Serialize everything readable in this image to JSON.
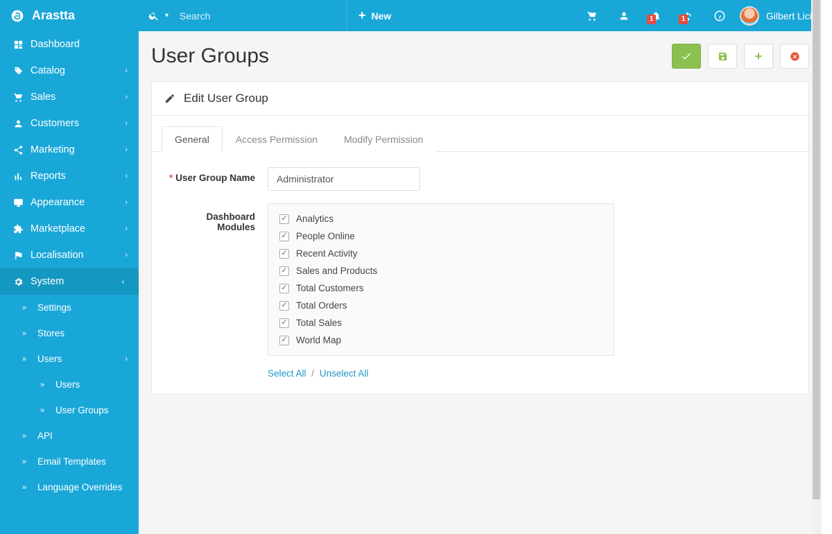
{
  "brand": {
    "name": "Arastta"
  },
  "topbar": {
    "search_placeholder": "Search",
    "new_label": "New",
    "bell_badge": "1",
    "sync_badge": "1",
    "user_name": "Gilbert Lici"
  },
  "sidebar": {
    "items": [
      {
        "label": "Dashboard",
        "icon": "dashboard",
        "expandable": false
      },
      {
        "label": "Catalog",
        "icon": "tag",
        "expandable": true
      },
      {
        "label": "Sales",
        "icon": "cart",
        "expandable": true
      },
      {
        "label": "Customers",
        "icon": "user",
        "expandable": true
      },
      {
        "label": "Marketing",
        "icon": "share",
        "expandable": true
      },
      {
        "label": "Reports",
        "icon": "bars",
        "expandable": true
      },
      {
        "label": "Appearance",
        "icon": "desktop",
        "expandable": true
      },
      {
        "label": "Marketplace",
        "icon": "puzzle",
        "expandable": true
      },
      {
        "label": "Localisation",
        "icon": "flag",
        "expandable": true
      },
      {
        "label": "System",
        "icon": "cog",
        "expandable": true,
        "expanded": true
      }
    ],
    "system_sub": [
      {
        "label": "Settings"
      },
      {
        "label": "Stores"
      },
      {
        "label": "Users",
        "expandable": true,
        "expanded": true
      },
      {
        "label": "API"
      },
      {
        "label": "Email Templates"
      },
      {
        "label": "Language Overrides"
      }
    ],
    "users_sub": [
      {
        "label": "Users"
      },
      {
        "label": "User Groups"
      }
    ]
  },
  "page": {
    "title": "User Groups",
    "panel_title": "Edit User Group",
    "tabs": [
      "General",
      "Access Permission",
      "Modify Permission"
    ],
    "active_tab": 0,
    "form": {
      "name_label": "User Group Name",
      "name_value": "Administrator",
      "modules_label": "Dashboard Modules",
      "modules": [
        {
          "label": "Analytics",
          "checked": true
        },
        {
          "label": "People Online",
          "checked": true
        },
        {
          "label": "Recent Activity",
          "checked": true
        },
        {
          "label": "Sales and Products",
          "checked": true
        },
        {
          "label": "Total Customers",
          "checked": true
        },
        {
          "label": "Total Orders",
          "checked": true
        },
        {
          "label": "Total Sales",
          "checked": true
        },
        {
          "label": "World Map",
          "checked": true
        }
      ],
      "select_all": "Select All",
      "unselect_all": "Unselect All"
    }
  },
  "colors": {
    "primary": "#19a7d8",
    "primary_dark": "#1497c1",
    "green": "#8cc152",
    "red": "#e9573f",
    "link": "#2196c9"
  }
}
